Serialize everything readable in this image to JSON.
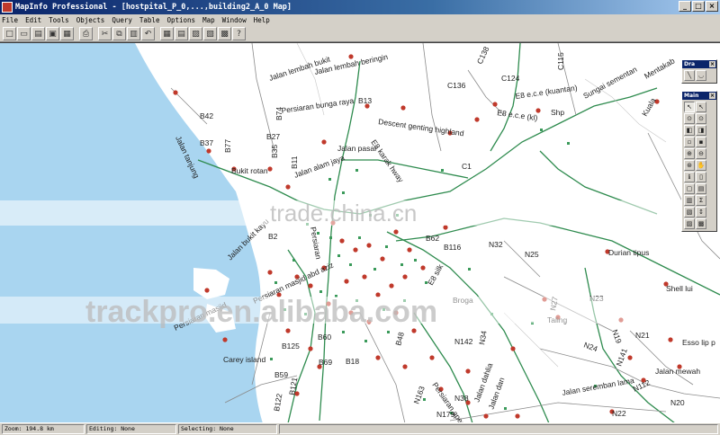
{
  "window": {
    "title": "MapInfo Professional - [hostpital_P_0,...,building2_A_0 Map]",
    "controls": [
      "_",
      "□",
      "×"
    ]
  },
  "menu": [
    "File",
    "Edit",
    "Tools",
    "Objects",
    "Query",
    "Table",
    "Options",
    "Map",
    "Window",
    "Help"
  ],
  "toolbar": {
    "icons": [
      "new-icon",
      "open-icon",
      "open-workspace-icon",
      "save-icon",
      "save-query-icon",
      "print-icon",
      "cut-icon",
      "copy-icon",
      "paste-icon",
      "undo-icon",
      "new-browser-icon",
      "new-mapper-icon",
      "new-grapher-icon",
      "new-layout-icon",
      "redistrict-icon",
      "help-icon"
    ],
    "glyphs": [
      "□",
      "▭",
      "▤",
      "▣",
      "▦",
      "⎙",
      "✂",
      "⧉",
      "▥",
      "↶",
      "▦",
      "▤",
      "▨",
      "▧",
      "▩",
      "?"
    ]
  },
  "map": {
    "labels": [
      "Jalan lembah bukit",
      "Jalan lembah beringin",
      "Jalan tanjung",
      "B42",
      "B74",
      "B37",
      "B77",
      "B27",
      "B35",
      "Bukit rotan",
      "B11",
      "Persiaran bunga raya",
      "B13",
      "E8 karak hway",
      "Descent genting highland",
      "C138",
      "C124",
      "C115",
      "C136",
      "E8 e.c.e (kuantan)",
      "Sungai sementan",
      "Mentakab",
      "E8 e.c.e (kl)",
      "Kuala",
      "Shp",
      "C1",
      "B2",
      "Jalan bukit kayu",
      "Persiaran masjid",
      "Persiaran",
      "B62",
      "B116",
      "N32",
      "N25",
      "Durian tipus",
      "Shell lui",
      "N27",
      "N23",
      "N24",
      "N19",
      "N21",
      "N141",
      "Esso lip p",
      "Jalan mewah",
      "N112",
      "Jalan seremban lama",
      "N20",
      "N22",
      "Broga",
      "Taling",
      "Carey island",
      "B125",
      "B59",
      "B121",
      "B122",
      "B60",
      "B69",
      "B18",
      "B48",
      "N142",
      "N34",
      "N38",
      "N163",
      "N179",
      "Jalan dahlia",
      "Persiaran apec",
      "Jalan dan",
      "E8 silk",
      "Persiaran masjid abd aziz",
      "Jalan alam jaya",
      "Jalan pasar"
    ]
  },
  "palettes": {
    "drawing_title": "Dra",
    "main_title": "Main",
    "close_glyph": "×",
    "drawing_glyphs": [
      "╲",
      "◡"
    ],
    "main_glyphs": [
      "↖",
      "↖",
      "⊙",
      "⊙",
      "◧",
      "◨",
      "▫",
      "▪",
      "⊕",
      "⊖",
      "⊛",
      "✋",
      "ℹ",
      "▯",
      "▢",
      "▤",
      "▥",
      "Σ",
      "▧",
      "↕",
      "▨",
      "▩"
    ]
  },
  "status": {
    "zoom": "Zoom: 194.8 km",
    "editing": "Editing: None",
    "selecting": "Selecting: None"
  },
  "watermarks": [
    "trade.china.cn",
    "trackpro.en.alibaba.com"
  ],
  "colors": {
    "sea": "#a9d5f0",
    "road_green": "#2e8b4e",
    "road_grey": "#888888",
    "hospital": "#c0392b",
    "building": "#3a9a5a"
  }
}
